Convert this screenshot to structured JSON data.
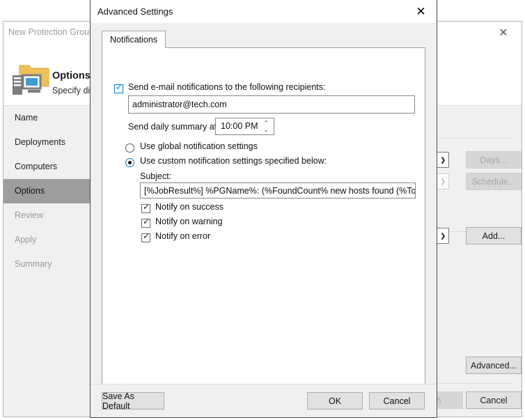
{
  "background_window": {
    "title": "New Protection Group",
    "close_icon": "✕",
    "header": {
      "title": "Options",
      "subtitle": "Specify dis",
      "icon": "protection-group-icon"
    },
    "steps": [
      {
        "label": "Name",
        "state": "normal"
      },
      {
        "label": "Deployments",
        "state": "normal"
      },
      {
        "label": "Computers",
        "state": "normal"
      },
      {
        "label": "Options",
        "state": "selected"
      },
      {
        "label": "Review",
        "state": "disabled"
      },
      {
        "label": "Apply",
        "state": "disabled"
      },
      {
        "label": "Summary",
        "state": "disabled"
      }
    ],
    "buttons": [
      {
        "name": "days-button",
        "label": "Days...",
        "disabled": true
      },
      {
        "name": "schedule-button",
        "label": "Schedule...",
        "disabled": true
      },
      {
        "name": "add-button",
        "label": "Add...",
        "disabled": false
      },
      {
        "name": "advanced-button",
        "label": "Advanced...",
        "disabled": false
      },
      {
        "name": "finish-button",
        "label": "h",
        "disabled": true
      },
      {
        "name": "cancel-button",
        "label": "Cancel",
        "disabled": false
      }
    ]
  },
  "dialog": {
    "title": "Advanced Settings",
    "close_icon": "✕",
    "tabs": [
      {
        "label": "Notifications",
        "selected": true
      }
    ],
    "send_email": {
      "checked": true,
      "check_glyph": "✓",
      "label": "Send e-mail notifications to the following recipients:",
      "recipients_value": "administrator@tech.com",
      "recipients_placeholder": ""
    },
    "daily_summary": {
      "label": "Send daily summary at:",
      "value": "10:00 PM",
      "spin_up_icon": "⌃",
      "spin_down_icon": "⌄"
    },
    "notification_mode": {
      "global": {
        "label": "Use global notification settings",
        "selected": false
      },
      "custom": {
        "label": "Use custom notification settings specified below:",
        "selected": true
      }
    },
    "subject": {
      "label": "Subject:",
      "value": "[%JobResult%] %PGName%: (%FoundCount% new hosts found (%TotalCo"
    },
    "notify_options": [
      {
        "label": "Notify on success",
        "checked": true,
        "check_glyph": "✓"
      },
      {
        "label": "Notify on warning",
        "checked": true,
        "check_glyph": "✓"
      },
      {
        "label": "Notify on error",
        "checked": true,
        "check_glyph": "✓"
      }
    ],
    "footer": {
      "save_as_default": "Save As Default",
      "ok": "OK",
      "cancel": "Cancel"
    }
  },
  "colors": {
    "accent": "#0078d7",
    "dialog_bg": "#f0f0f0",
    "panel_bg": "#ffffff",
    "selected_step_bg": "#9d9d9d",
    "folder_icon": "#eec05a",
    "monitor_icon": "#3f9bd1"
  }
}
